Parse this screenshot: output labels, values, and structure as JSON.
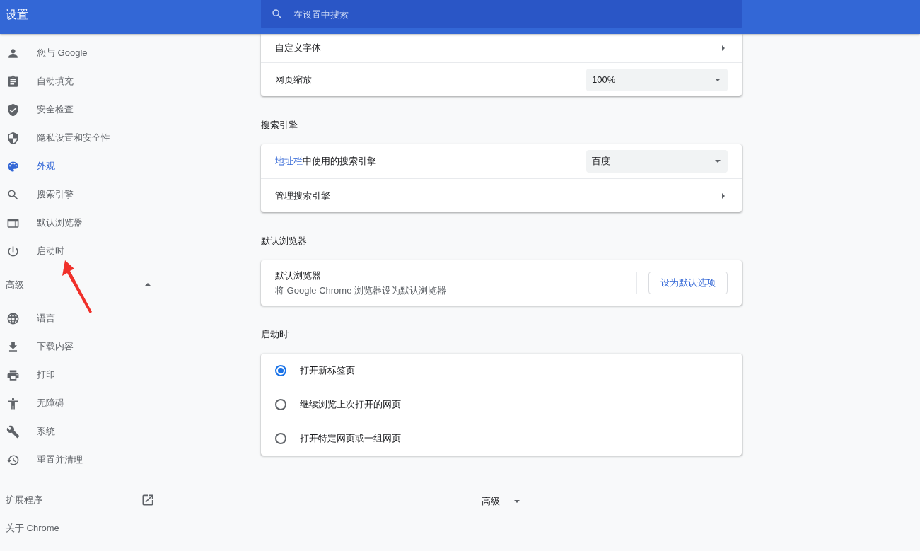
{
  "header": {
    "title": "设置",
    "search": {
      "placeholder": "在设置中搜索"
    }
  },
  "sidebar": {
    "items": [
      {
        "label": "您与 Google",
        "selected": false
      },
      {
        "label": "自动填充",
        "selected": false
      },
      {
        "label": "安全检查",
        "selected": false
      },
      {
        "label": "隐私设置和安全性",
        "selected": false
      },
      {
        "label": "外观",
        "selected": true
      },
      {
        "label": "搜索引擎",
        "selected": false
      },
      {
        "label": "默认浏览器",
        "selected": false
      },
      {
        "label": "启动时",
        "selected": false
      }
    ],
    "advanced": {
      "label": "高级",
      "expanded": true,
      "items": [
        {
          "label": "语言",
          "selected": false
        },
        {
          "label": "下载内容",
          "selected": false
        },
        {
          "label": "打印",
          "selected": false
        },
        {
          "label": "无障碍",
          "selected": false
        },
        {
          "label": "系统",
          "selected": false
        },
        {
          "label": "重置并清理",
          "selected": false
        }
      ]
    },
    "extensions": {
      "label": "扩展程序"
    },
    "about": {
      "label": "关于 Chrome"
    }
  },
  "main": {
    "appearance_card": {
      "rows": [
        {
          "kind": "link",
          "label": "自定义字体"
        },
        {
          "kind": "select",
          "label": "网页缩放",
          "value": "100%"
        }
      ]
    },
    "search_engine": {
      "title": "搜索引擎",
      "rows": [
        {
          "kind": "select",
          "link": "地址栏",
          "label": "中使用的搜索引擎",
          "value": "百度"
        },
        {
          "kind": "link",
          "label": "管理搜索引擎"
        }
      ]
    },
    "default_browser": {
      "title": "默认浏览器",
      "label": "默认浏览器",
      "sublabel": "将 Google Chrome 浏览器设为默认浏览器",
      "button": "设为默认选项"
    },
    "on_startup": {
      "title": "启动时",
      "options": [
        {
          "label": "打开新标签页",
          "selected": true
        },
        {
          "label": "继续浏览上次打开的网页",
          "selected": false
        },
        {
          "label": "打开特定网页或一组网页",
          "selected": false
        }
      ]
    },
    "advanced_button": {
      "label": "高级",
      "expanded": false
    }
  }
}
